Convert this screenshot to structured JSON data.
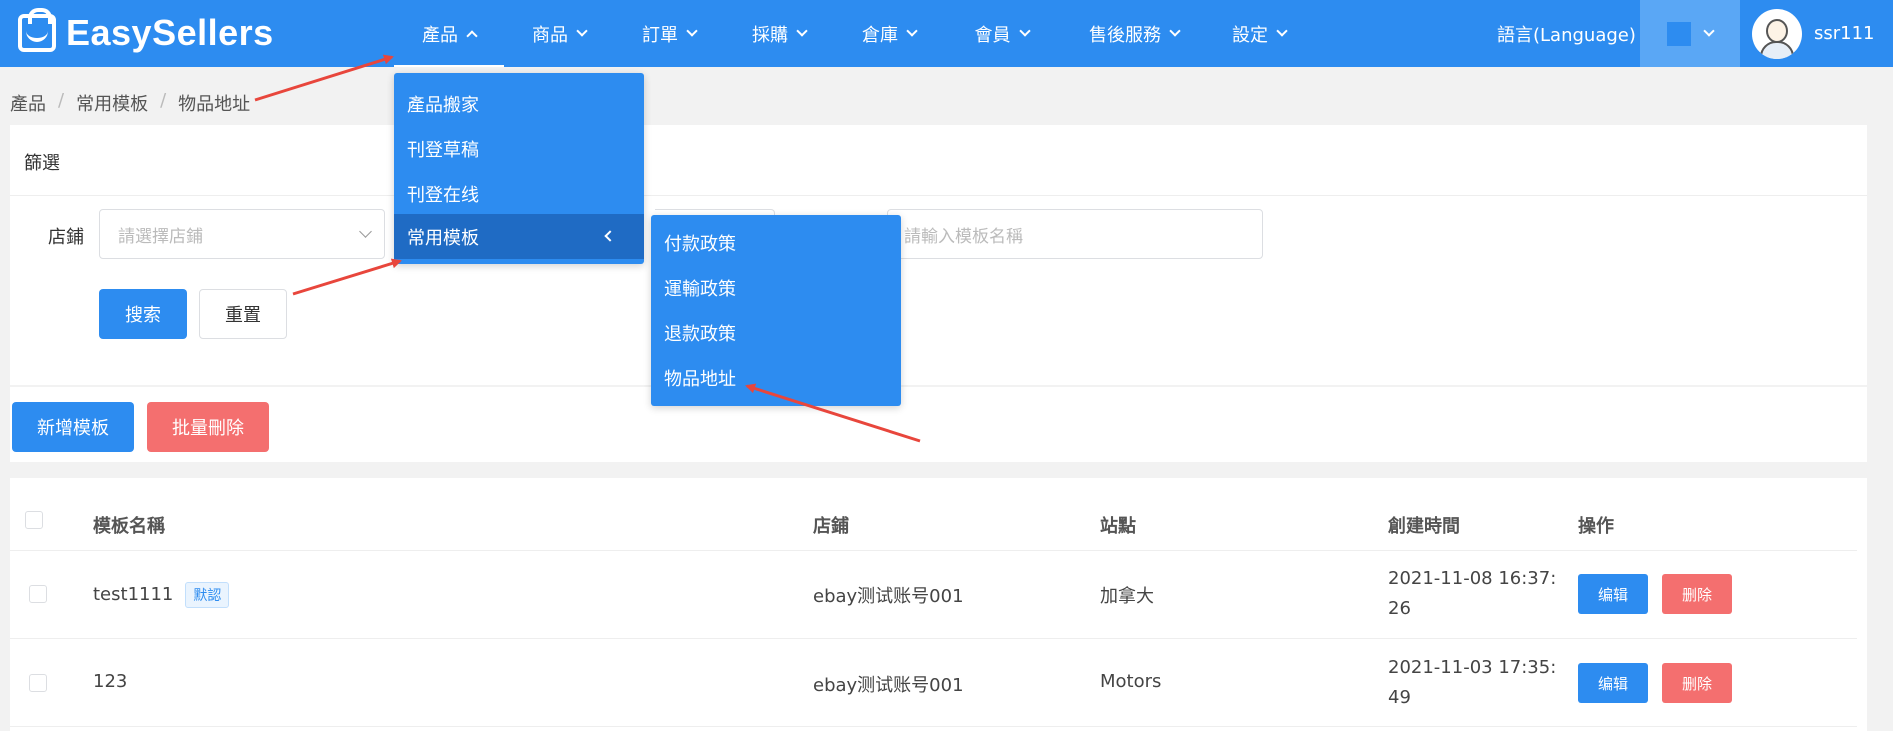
{
  "header": {
    "logo_text": "EasySellers",
    "nav": [
      {
        "label": "產品",
        "active": true
      },
      {
        "label": "商品"
      },
      {
        "label": "訂單"
      },
      {
        "label": "採購"
      },
      {
        "label": "倉庫"
      },
      {
        "label": "會員"
      },
      {
        "label": "售後服務"
      },
      {
        "label": "設定"
      }
    ],
    "language": "語言(Language)",
    "username": "ssr111"
  },
  "breadcrumb": [
    "產品",
    "常用模板",
    "物品地址"
  ],
  "filter": {
    "title": "篩選",
    "store_label": "店鋪",
    "store_placeholder": "請選擇店鋪",
    "name_placeholder": "請輸入模板名稱",
    "search_button": "搜索",
    "reset_button": "重置"
  },
  "actions": {
    "add_button": "新增模板",
    "batch_delete_button": "批量刪除"
  },
  "table": {
    "columns": [
      "模板名稱",
      "店鋪",
      "站點",
      "創建時間",
      "操作"
    ],
    "rows": [
      {
        "name": "test1111",
        "badge": "默認",
        "store": "ebay测试账号001",
        "site": "加拿大",
        "created": "2021-11-08 16:37:26",
        "edit": "编辑",
        "delete": "删除"
      },
      {
        "name": "123",
        "badge": "",
        "store": "ebay测试账号001",
        "site": "Motors",
        "created": "2021-11-03 17:35:49",
        "edit": "编辑",
        "delete": "删除"
      }
    ]
  },
  "menu_product": {
    "items": [
      "產品搬家",
      "刊登草稿",
      "刊登在线",
      "常用模板"
    ]
  },
  "menu_templates": {
    "items": [
      "付款政策",
      "運輸政策",
      "退款政策",
      "物品地址"
    ]
  },
  "colors": {
    "primary": "#2d8cf0",
    "danger": "#f46f6f",
    "annotation_arrow": "#e8463c"
  }
}
